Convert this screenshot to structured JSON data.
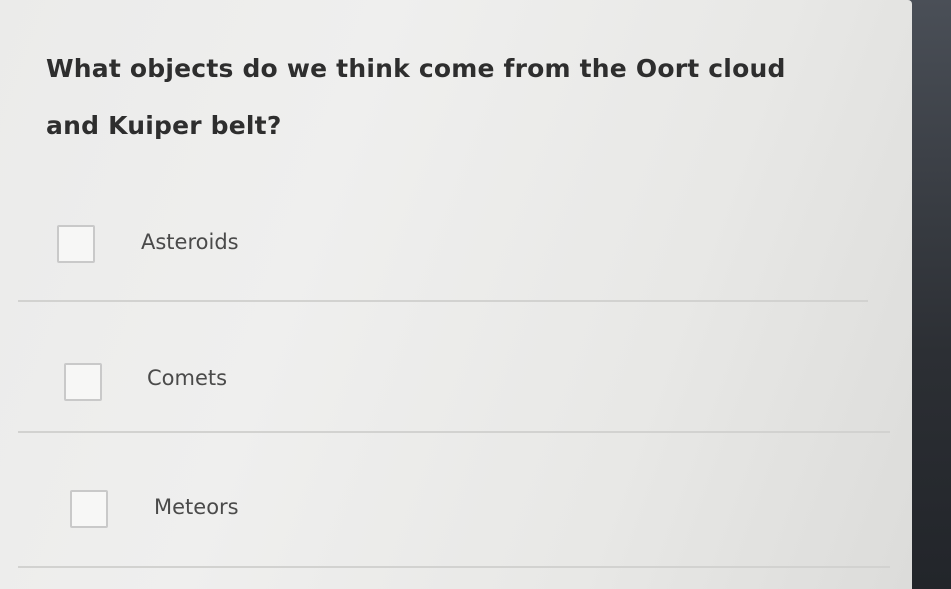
{
  "quiz": {
    "question": "What objects do we think come from the Oort cloud and Kuiper belt?",
    "options": [
      {
        "label": "Asteroids",
        "checked": false
      },
      {
        "label": "Comets",
        "checked": false
      },
      {
        "label": "Meteors",
        "checked": false
      }
    ]
  },
  "colors": {
    "card_background": "#ececeb",
    "question_text": "#2e2e2e",
    "option_text": "#4a4a4a",
    "checkbox_border": "#c9c9c9",
    "divider": "#d2d2d0",
    "left_accent": "#3f4aa0"
  }
}
